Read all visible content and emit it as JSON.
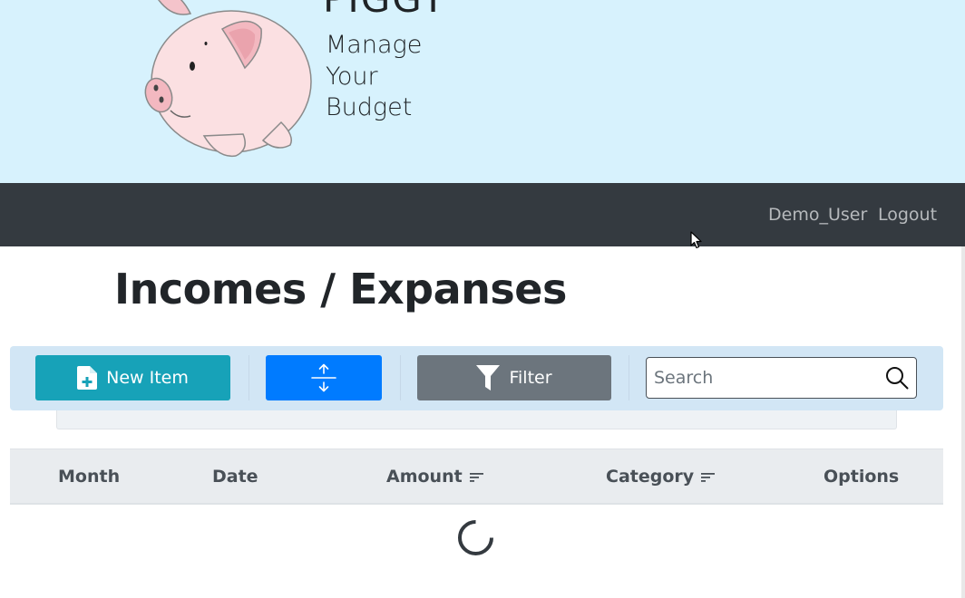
{
  "brand": {
    "title": "PIGGY",
    "tagline": [
      "Manage",
      "Your",
      "Budget"
    ],
    "logo_icon": "piggy-bank-logo"
  },
  "navbar": {
    "user": "Demo_User",
    "logout": "Logout"
  },
  "page": {
    "title": "Incomes / Expanses"
  },
  "toolbar": {
    "new_item": {
      "label": "New Item",
      "icon": "file-plus-icon"
    },
    "expand": {
      "label": "",
      "icon": "expand-vertical-icon"
    },
    "filter": {
      "label": "Filter",
      "icon": "funnel-icon"
    },
    "search": {
      "placeholder": "Search",
      "value": "",
      "icon": "search-icon"
    }
  },
  "table": {
    "columns": [
      {
        "label": "Month",
        "sortable": false
      },
      {
        "label": "Date",
        "sortable": false
      },
      {
        "label": "Amount",
        "sortable": true
      },
      {
        "label": "Category",
        "sortable": true
      },
      {
        "label": "Options",
        "sortable": false
      }
    ],
    "state": "loading"
  },
  "colors": {
    "header_bg": "#d7f2fd",
    "navbar_bg": "#343a40",
    "btn_new": "#17a2b8",
    "btn_expand": "#007bff",
    "btn_filter": "#6c757d",
    "toolbar_bg": "#d2e6f5"
  }
}
